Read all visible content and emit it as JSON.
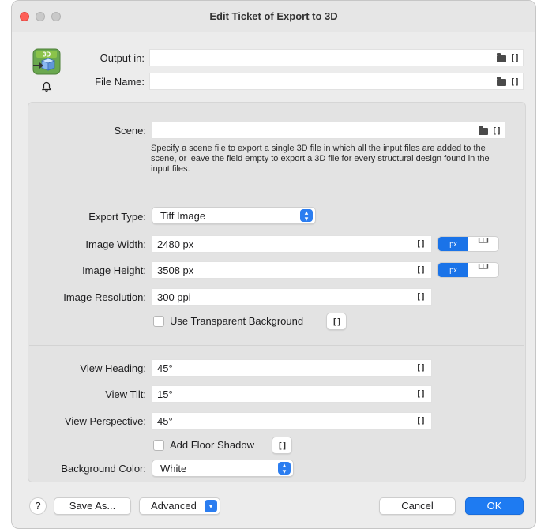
{
  "window": {
    "title": "Edit Ticket of Export to 3D"
  },
  "app_icon": {
    "text": "3D"
  },
  "output": {
    "label": "Output in:",
    "value": ""
  },
  "file_name": {
    "label": "File Name:",
    "value": ""
  },
  "scene": {
    "label": "Scene:",
    "value": "",
    "help": "Specify a scene file to export a single 3D file in which all the input files are added to the scene, or leave the field empty to export a 3D file for every structural design found in the input files."
  },
  "export_type": {
    "label": "Export Type:",
    "value": "Tiff Image"
  },
  "image_width": {
    "label": "Image Width:",
    "value": "2480 px"
  },
  "image_height": {
    "label": "Image Height:",
    "value": "3508 px"
  },
  "image_resolution": {
    "label": "Image Resolution:",
    "value": "300 ppi"
  },
  "unit_toggle": {
    "px": "px"
  },
  "transparent_bg": {
    "label": "Use Transparent Background",
    "checked": false
  },
  "view_heading": {
    "label": "View Heading:",
    "value": "45°"
  },
  "view_tilt": {
    "label": "View Tilt:",
    "value": "15°"
  },
  "view_perspective": {
    "label": "View Perspective:",
    "value": "45°"
  },
  "floor_shadow": {
    "label": "Add Floor Shadow",
    "checked": false
  },
  "background_color": {
    "label": "Background Color:",
    "value": "White"
  },
  "buttons": {
    "help": "?",
    "save_as": "Save As...",
    "advanced": "Advanced",
    "cancel": "Cancel",
    "ok": "OK"
  },
  "icons": {
    "bracket": "[]"
  },
  "colors": {
    "accent": "#1e7bf2",
    "close": "#fe5f57"
  }
}
